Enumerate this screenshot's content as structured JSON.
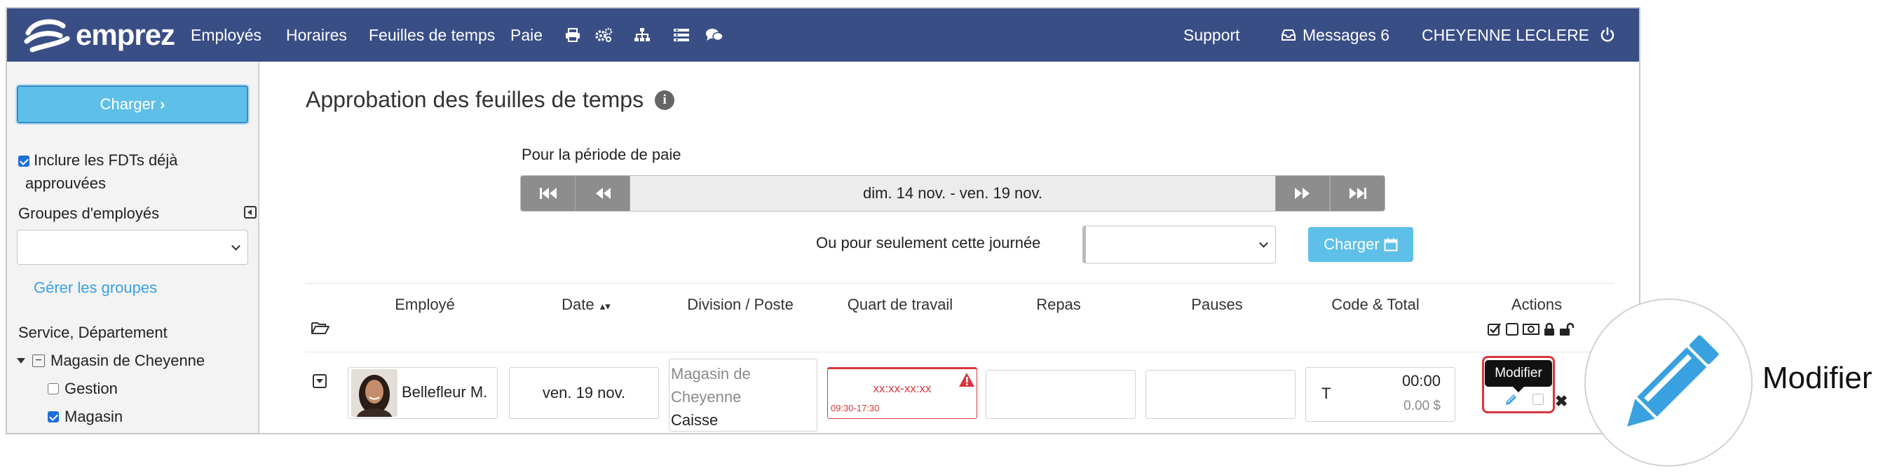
{
  "navbar": {
    "brand": "emprez",
    "menu": [
      "Employés",
      "Horaires",
      "Feuilles de temps",
      "Paie"
    ],
    "support": "Support",
    "messages": "Messages 6",
    "user": "CHEYENNE LECLERE",
    "bg_color": "#3a4e86"
  },
  "sidebar": {
    "load_button": "Charger",
    "include_approved_line1": "Inclure les FDTs déjà",
    "include_approved_line2": "approuvées",
    "include_approved_checked": true,
    "groups_label": "Groupes d'employés",
    "groups_select_value": "",
    "manage_groups_link": "Gérer les groupes",
    "service_label": "Service, Département",
    "tree_root": "Magasin de Cheyenne",
    "tree_children": [
      {
        "label": "Gestion",
        "checked": false
      },
      {
        "label": "Magasin",
        "checked": true
      }
    ]
  },
  "main": {
    "title": "Approbation des feuilles de temps",
    "period_caption": "Pour la période de paie",
    "period_range": "dim. 14 nov. - ven. 19 nov.",
    "day_caption": "Ou pour seulement cette journée",
    "day_select_value": "",
    "load_day_button": "Charger",
    "accent_color": "#5ec0e8"
  },
  "table": {
    "headers": {
      "employee": "Employé",
      "date": "Date",
      "division": "Division / Poste",
      "shift": "Quart de travail",
      "meals": "Repas",
      "breaks": "Pauses",
      "code_total": "Code & Total",
      "actions": "Actions"
    },
    "row": {
      "employee": "Bellefleur M.",
      "date": "ven. 19 nov.",
      "division_line1": "Magasin de",
      "division_line2": "Cheyenne",
      "position": "Caisse",
      "shift_value": "xx:xx-xx:xx",
      "shift_scheduled": "09:30-17:30",
      "meals": "",
      "breaks": "",
      "code": "T",
      "total_time": "00:00",
      "total_amount": "0.00 $"
    },
    "tooltip": "Modifier",
    "error_color": "#d9363e"
  },
  "zoom_callout": {
    "label": "Modifier",
    "icon": "pencil-icon",
    "icon_color": "#3aa1e0"
  }
}
